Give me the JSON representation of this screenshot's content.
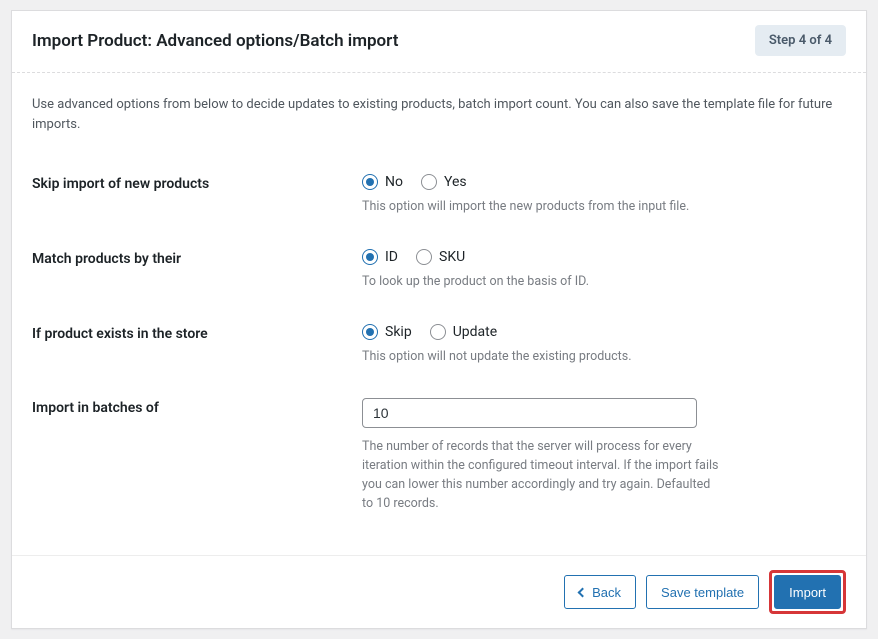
{
  "header": {
    "title": "Import Product: Advanced options/Batch import",
    "step_badge": "Step 4 of 4"
  },
  "intro": "Use advanced options from below to decide updates to existing products, batch import count. You can also save the template file for future imports.",
  "fields": {
    "skip_import": {
      "label": "Skip import of new products",
      "option_no": "No",
      "option_yes": "Yes",
      "help": "This option will import the new products from the input file."
    },
    "match_by": {
      "label": "Match products by their",
      "option_id": "ID",
      "option_sku": "SKU",
      "help": "To look up the product on the basis of ID."
    },
    "if_exists": {
      "label": "If product exists in the store",
      "option_skip": "Skip",
      "option_update": "Update",
      "help": "This option will not update the existing products."
    },
    "batch": {
      "label": "Import in batches of",
      "value": "10",
      "help": "The number of records that the server will process for every iteration within the configured timeout interval. If the import fails you can lower this number accordingly and try again. Defaulted to 10 records."
    }
  },
  "footer": {
    "back": "Back",
    "save_template": "Save template",
    "import": "Import"
  }
}
